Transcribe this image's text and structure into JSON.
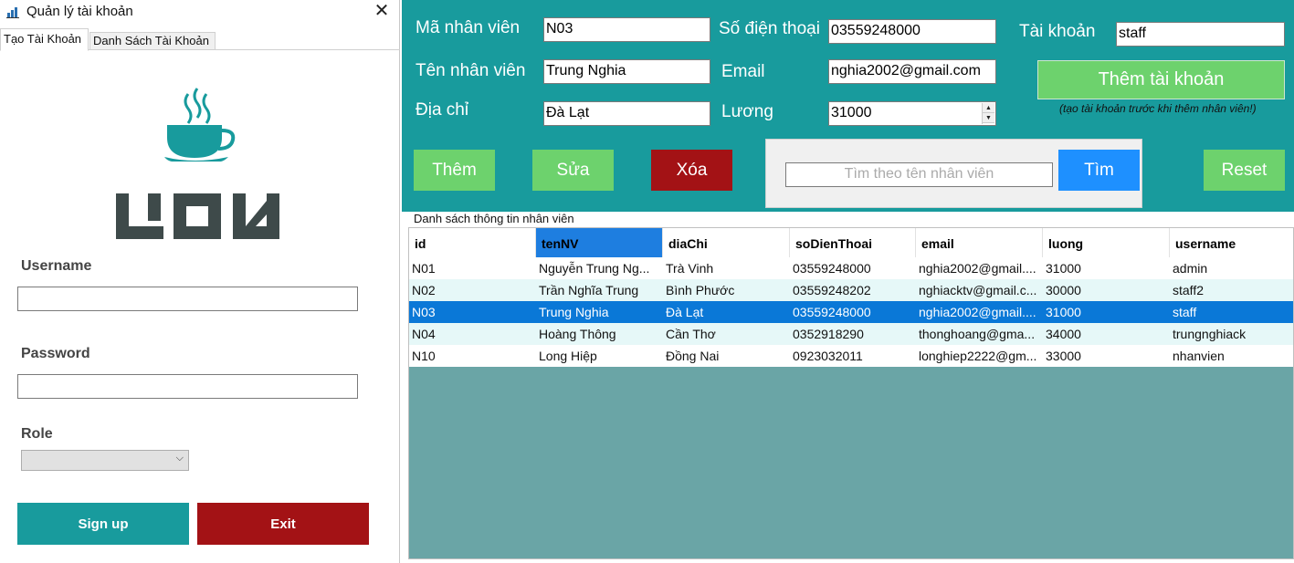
{
  "left": {
    "title": "Quản lý tài khoản",
    "close_glyph": "✕",
    "tabs": [
      "Tạo Tài Khoản",
      "Danh Sách Tài Khoản"
    ],
    "username_label": "Username",
    "username_value": "",
    "password_label": "Password",
    "password_value": "",
    "role_label": "Role",
    "role_value": "",
    "signup_label": "Sign up",
    "exit_label": "Exit"
  },
  "right": {
    "labels": {
      "ma_nv": "Mã nhân viên",
      "ten_nv": "Tên nhân viên",
      "dia_chi": "Địa chỉ",
      "sdt": "Số điện thoại",
      "email": "Email",
      "luong": "Lương",
      "tai_khoan": "Tài khoản"
    },
    "values": {
      "ma_nv": "N03",
      "ten_nv": "Trung Nghia",
      "dia_chi": "Đà Lạt",
      "sdt": "03559248000",
      "email": "nghia2002@gmail.com",
      "luong": "31000",
      "tai_khoan": "staff"
    },
    "add_account_label": "Thêm tài khoản",
    "hint": "(tạo tài khoản trước khi thêm nhân viên!)",
    "buttons": {
      "add": "Thêm",
      "edit": "Sửa",
      "delete": "Xóa",
      "search": "Tìm",
      "reset": "Reset"
    },
    "search_placeholder": "Tìm theo tên nhân viên",
    "group_label": "Danh sách thông tin nhân viên",
    "table": {
      "headers": [
        "id",
        "tenNV",
        "diaChi",
        "soDienThoai",
        "email",
        "luong",
        "username"
      ],
      "selected_header": 1,
      "selected_row": 2,
      "rows": [
        [
          "N01",
          "Nguyễn Trung Ng...",
          "Trà Vinh",
          "03559248000",
          "nghia2002@gmail....",
          "31000",
          "admin"
        ],
        [
          "N02",
          "Trần Nghĩa Trung",
          "Bình Phước",
          "03559248202",
          "nghiacktv@gmail.c...",
          "30000",
          "staff2"
        ],
        [
          "N03",
          "Trung Nghia",
          "Đà Lạt",
          "03559248000",
          "nghia2002@gmail....",
          "31000",
          "staff"
        ],
        [
          "N04",
          "Hoàng Thông",
          "Cần Thơ",
          "0352918290",
          "thonghoang@gma...",
          "34000",
          "trungnghiack"
        ],
        [
          "N10",
          "Long Hiệp",
          "Đồng Nai",
          "0923032011",
          "longhiep2222@gm...",
          "33000",
          "nhanvien"
        ]
      ]
    }
  },
  "colors": {
    "teal": "#189b9d",
    "green": "#6dd26d",
    "red": "#a31215",
    "blue": "#1e90ff",
    "grid_bg": "#6aa5a6",
    "row_alt": "#e6f8f8",
    "row_selected": "#0a78d7"
  }
}
